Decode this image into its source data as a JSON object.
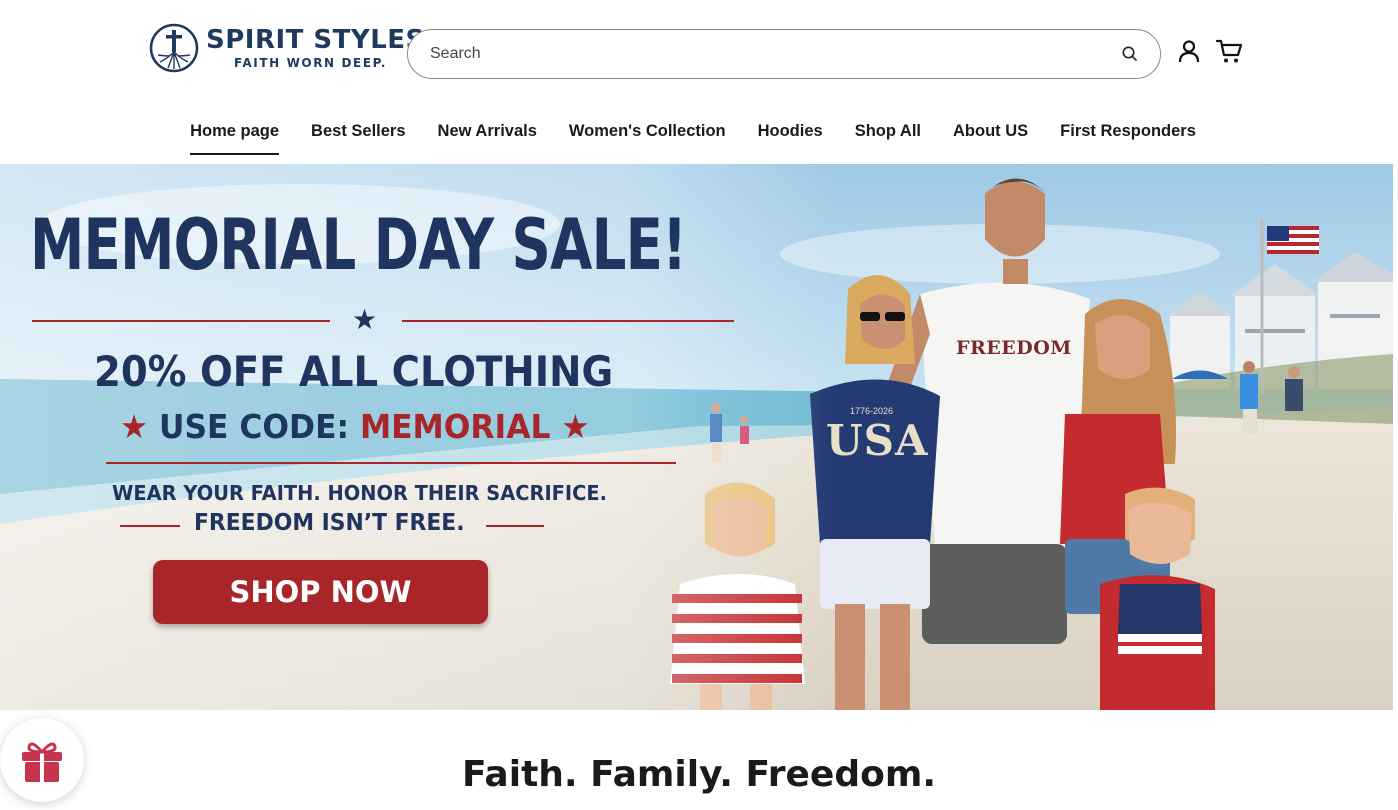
{
  "brand": {
    "name": "SPIRIT STYLES",
    "tagline": "FAITH WORN DEEP."
  },
  "search": {
    "placeholder": "Search",
    "value": ""
  },
  "header_icons": [
    "search-icon",
    "account-icon",
    "cart-icon"
  ],
  "nav": {
    "items": [
      {
        "label": "Home page",
        "active": true
      },
      {
        "label": "Best Sellers",
        "active": false
      },
      {
        "label": "New Arrivals",
        "active": false
      },
      {
        "label": "Women's Collection",
        "active": false
      },
      {
        "label": "Hoodies",
        "active": false
      },
      {
        "label": "Shop All",
        "active": false
      },
      {
        "label": "About US",
        "active": false
      },
      {
        "label": "First Responders",
        "active": false
      }
    ]
  },
  "hero": {
    "title": "MEMORIAL DAY SALE!",
    "discount": "20% OFF ALL CLOTHING",
    "code_prefix": "USE CODE:",
    "code": "MEMORIAL",
    "tagline1": "WEAR YOUR FAITH. HONOR THEIR SACRIFICE.",
    "tagline2": "FREEDOM ISN’T FREE.",
    "cta": "SHOP NOW",
    "shirt_text_1": "FREEDOM",
    "shirt_text_2": "USA",
    "shirt_text_3": "1776-2026"
  },
  "section": {
    "title": "Faith. Family. Freedom."
  },
  "colors": {
    "navy": "#1f3560",
    "red": "#a8262a",
    "logo": "#1f3a5f"
  },
  "floating": {
    "gift_icon": "gift-icon"
  }
}
